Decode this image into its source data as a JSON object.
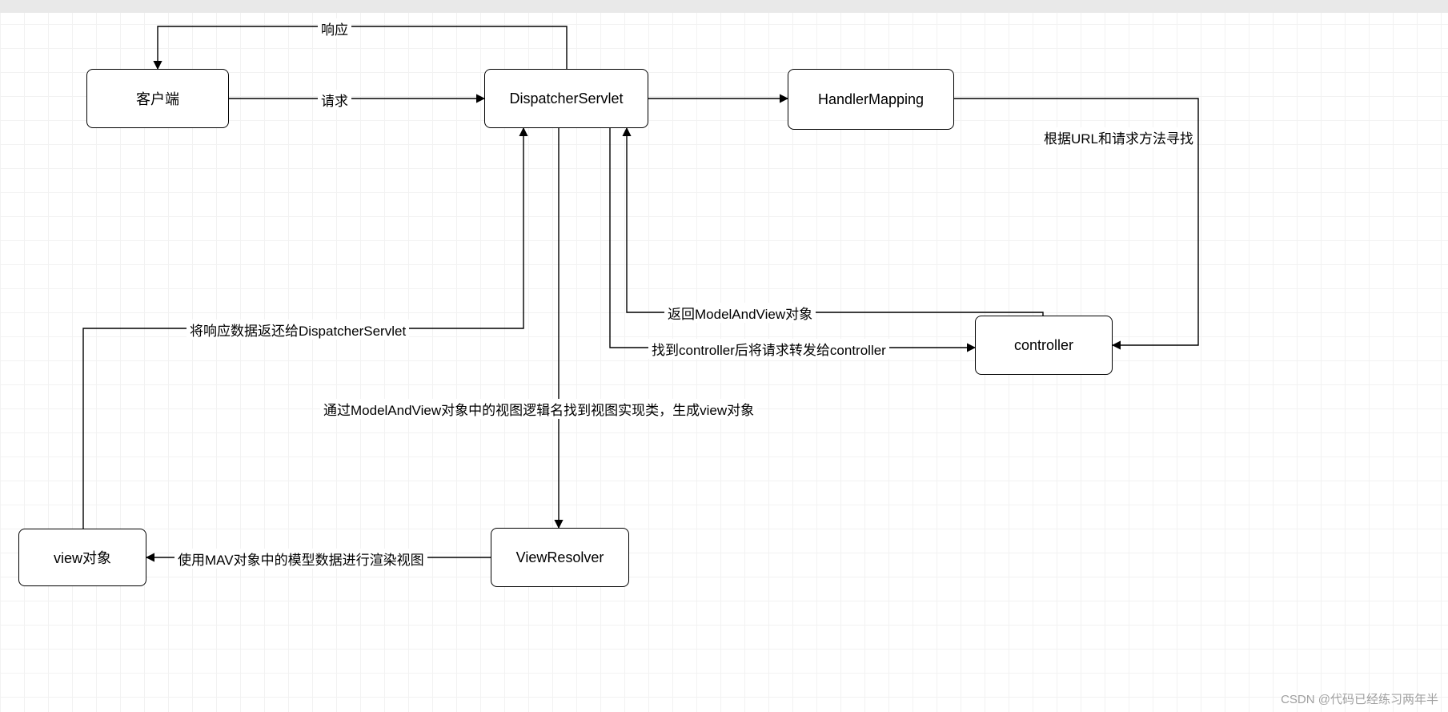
{
  "watermark": "CSDN @代码已经练习两年半",
  "nodes": {
    "client": {
      "label": "客户端"
    },
    "dispatcher": {
      "label": "DispatcherServlet"
    },
    "handler_mapping": {
      "label": "HandlerMapping"
    },
    "controller": {
      "label": "controller"
    },
    "view_resolver": {
      "label": "ViewResolver"
    },
    "view_obj": {
      "label": "view对象"
    }
  },
  "edges": {
    "response": {
      "label": "响应"
    },
    "request": {
      "label": "请求"
    },
    "find_by_url": {
      "label": "根据URL和请求方法寻找"
    },
    "forward_to_controller": {
      "label": "找到controller后将请求转发给controller"
    },
    "return_mav": {
      "label": "返回ModelAndView对象"
    },
    "to_view_resolver": {
      "label": "通过ModelAndView对象中的视图逻辑名找到视图实现类，生成view对象"
    },
    "render_view": {
      "label": "使用MAV对象中的模型数据进行渲染视图"
    },
    "return_to_dispatcher": {
      "label": "将响应数据返还给DispatcherServlet"
    }
  }
}
